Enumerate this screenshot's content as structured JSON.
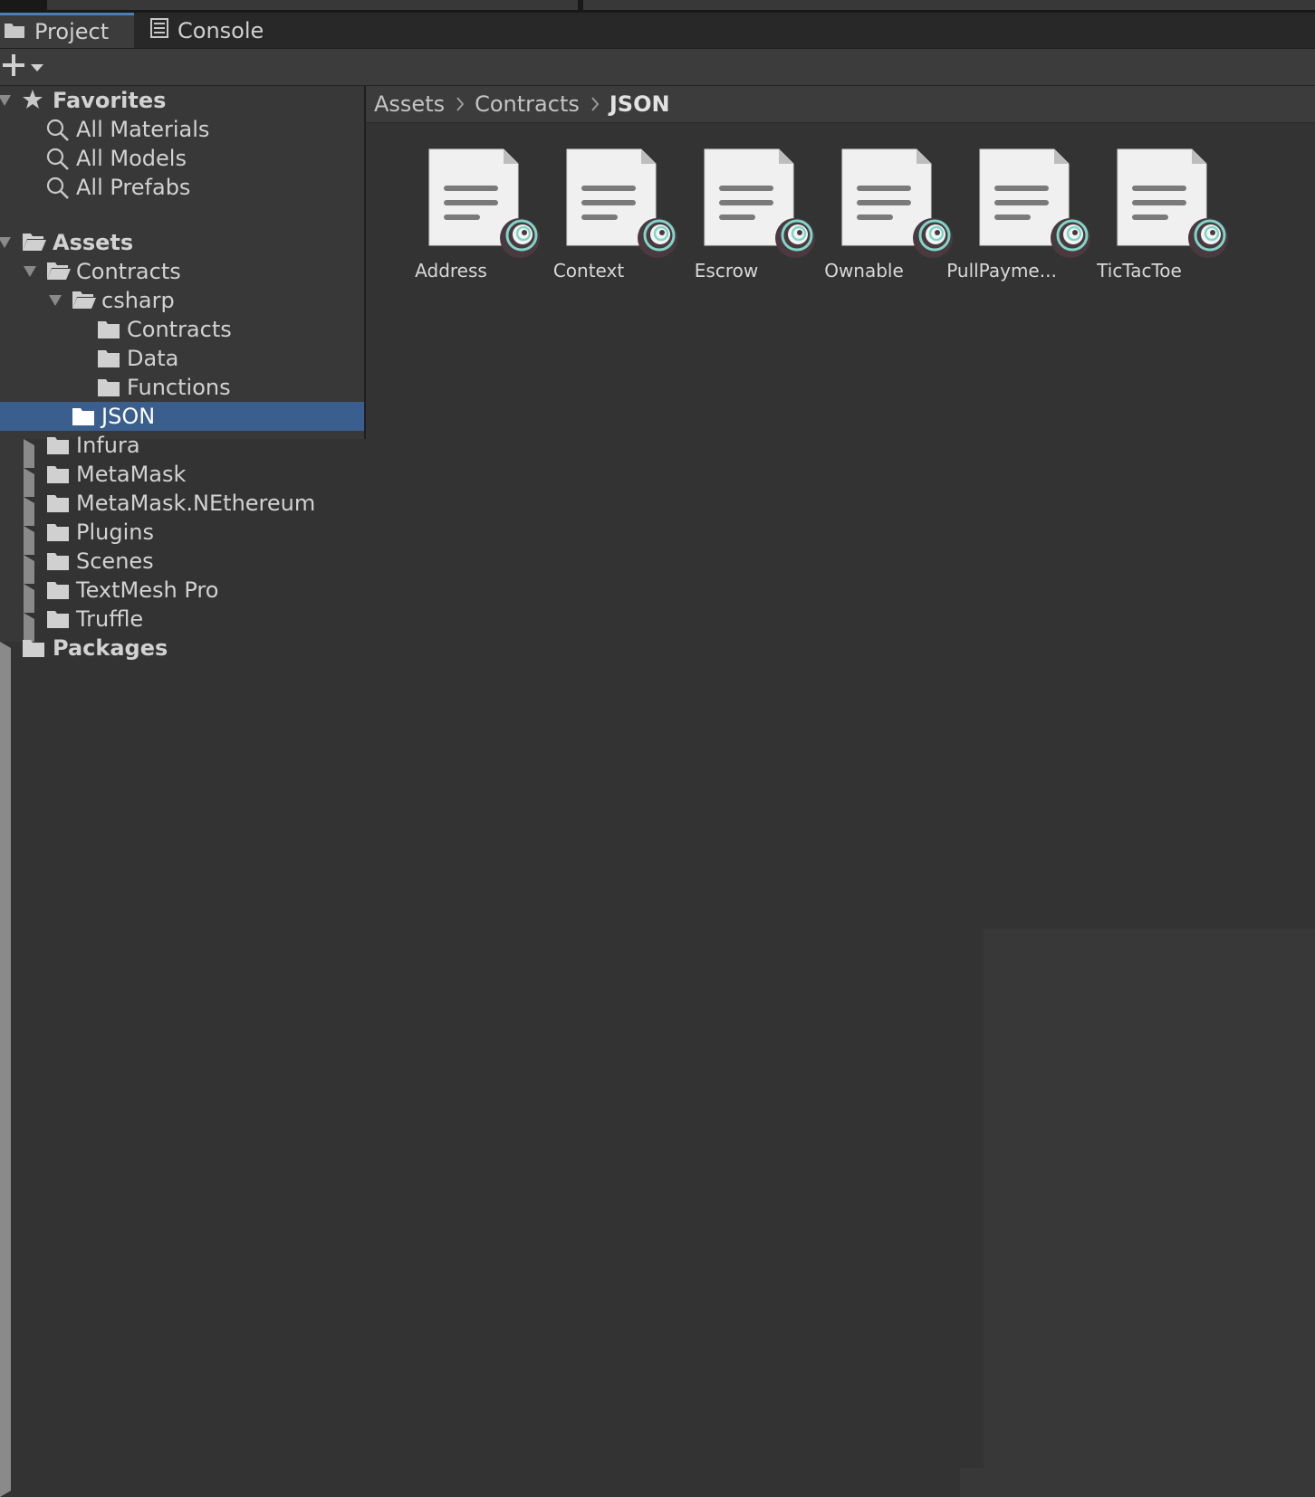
{
  "tabs": {
    "project": {
      "label": "Project",
      "icon": "folder-icon"
    },
    "console": {
      "label": "Console",
      "icon": "console-icon"
    }
  },
  "toolbar": {
    "add_icon": "plus-icon",
    "dropdown_icon": "chevron-down-icon"
  },
  "tree": {
    "favorites": {
      "label": "Favorites",
      "items": [
        {
          "label": "All Materials"
        },
        {
          "label": "All Models"
        },
        {
          "label": "All Prefabs"
        }
      ]
    },
    "assets": {
      "label": "Assets",
      "contracts": "Contracts",
      "csharp": "csharp",
      "csharp_children": [
        "Contracts",
        "Data",
        "Functions"
      ],
      "selected": "JSON",
      "siblings": [
        "Infura",
        "MetaMask",
        "MetaMask.NEthereum",
        "Plugins",
        "Scenes",
        "TextMesh Pro",
        "Truffle"
      ]
    },
    "packages": {
      "label": "Packages"
    }
  },
  "breadcrumb": [
    "Assets",
    "Contracts",
    "JSON"
  ],
  "files": [
    {
      "name": "Address"
    },
    {
      "name": "Context"
    },
    {
      "name": "Escrow"
    },
    {
      "name": "Ownable"
    },
    {
      "name": "PullPayme..."
    },
    {
      "name": "TicTacToe"
    }
  ],
  "colors": {
    "selection": "#3a5f8e",
    "tab_accent": "#4a7fb8",
    "badge_ring": "#7fd6c8",
    "badge_dark": "#4a3a40"
  }
}
